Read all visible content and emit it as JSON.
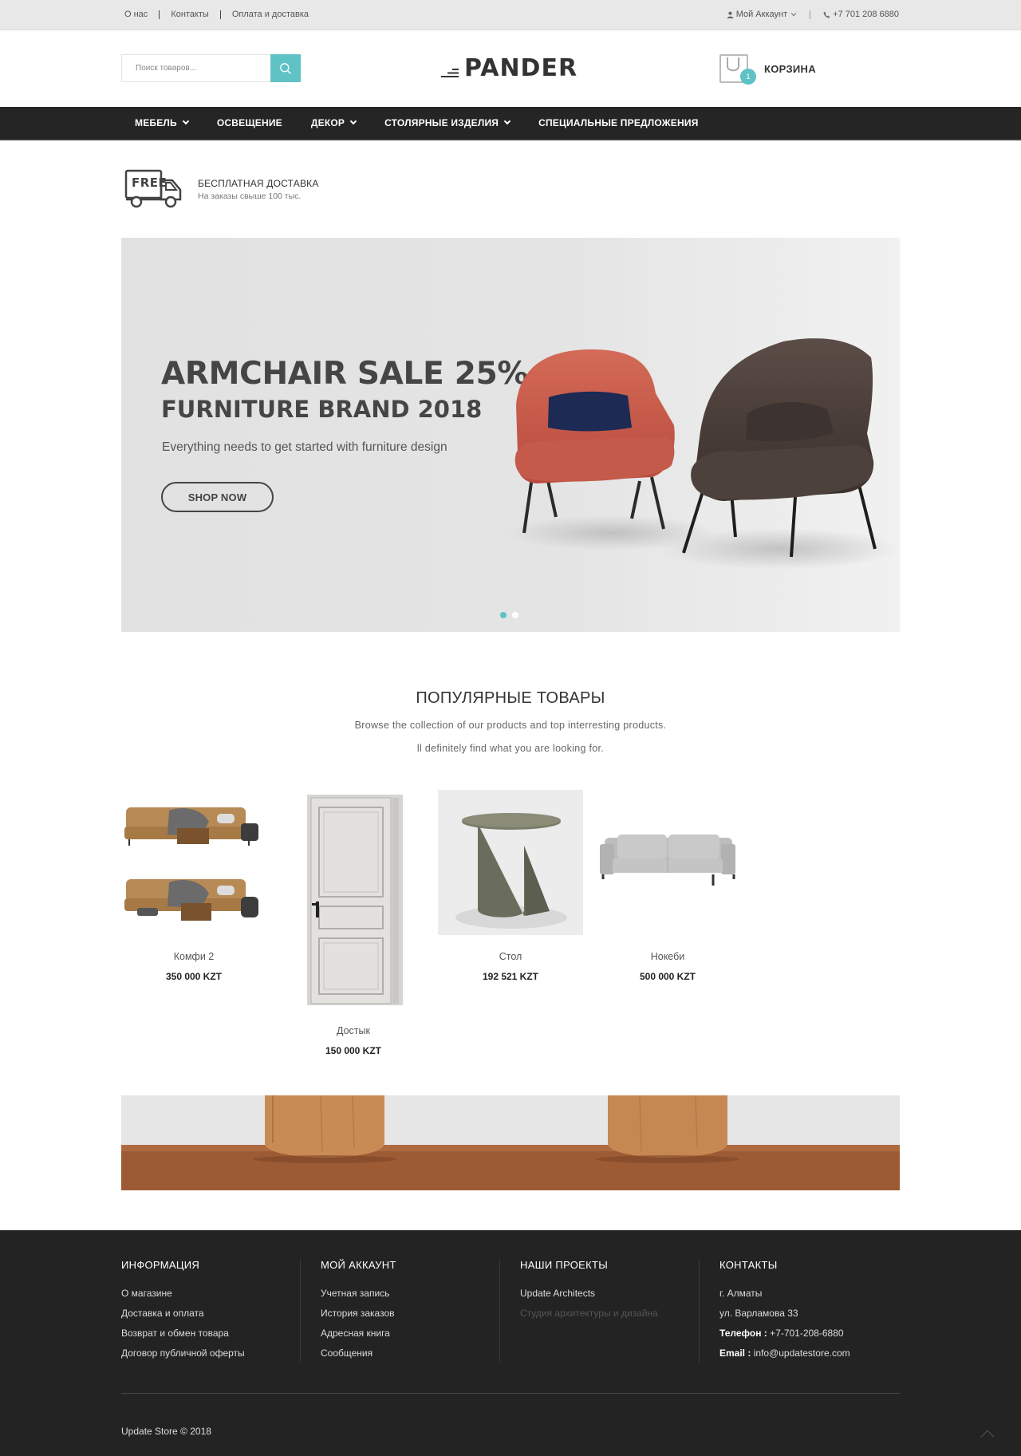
{
  "topbar": {
    "links": [
      "О нас",
      "Контакты",
      "Оплата и доставка"
    ],
    "account": "Мой Аккаунт",
    "phone": "+7 701 208 6880"
  },
  "header": {
    "search_placeholder": "Поиск товаров...",
    "logo": "PANDER",
    "cart_label": "КОРЗИНА",
    "cart_count": "1"
  },
  "nav": {
    "items": [
      {
        "label": "МЕБЕЛЬ",
        "has_dropdown": true
      },
      {
        "label": "ОСВЕЩЕНИЕ",
        "has_dropdown": false
      },
      {
        "label": "ДЕКОР",
        "has_dropdown": true
      },
      {
        "label": "СТОЛЯРНЫЕ ИЗДЕЛИЯ",
        "has_dropdown": true
      },
      {
        "label": "СПЕЦИАЛЬНЫЕ ПРЕДЛОЖЕНИЯ",
        "has_dropdown": false
      }
    ]
  },
  "shipping": {
    "badge": "FREE",
    "title": "БЕСПЛАТНАЯ ДОСТАВКА",
    "subtitle": "На заказы свыше 100 тыс."
  },
  "slider": {
    "heading": "ARMCHAIR SALE 25% OFF",
    "subheading": "FURNITURE BRAND 2018",
    "description": "Everything needs to get started with furniture design",
    "button": "SHOP NOW",
    "slides": 2,
    "active_slide": 1
  },
  "popular": {
    "title": "ПОПУЛЯРНЫЕ ТОВАРЫ",
    "subtitle_1": "Browse the collection of our products and top interresting products.",
    "subtitle_2": "ll definitely find what you are looking for.",
    "products": [
      {
        "name": "Комфи 2",
        "price": "350 000 KZT",
        "image": "sofa-set-image"
      },
      {
        "name": "Достык",
        "price": "150 000 KZT",
        "image": "door-image"
      },
      {
        "name": "Стол",
        "price": "192 521 KZT",
        "image": "side-table-image"
      },
      {
        "name": "Нокеби",
        "price": "500 000 KZT",
        "image": "grey-sofa-image"
      }
    ]
  },
  "footer": {
    "columns": [
      {
        "title": "ИНФОРМАЦИЯ",
        "items": [
          "О магазине",
          "Доставка и оплата",
          "Возврат и обмен товара",
          "Договор публичной оферты"
        ]
      },
      {
        "title": "МОЙ АККАУНТ",
        "items": [
          "Учетная запись",
          "История заказов",
          "Адресная книга",
          "Сообщения"
        ]
      },
      {
        "title": "НАШИ ПРОЕКТЫ",
        "items": [
          "Update Architects",
          "Студия архитектуры и дизайна"
        ]
      },
      {
        "title": "КОНТАКТЫ",
        "city": "г. Алматы",
        "address": "ул. Варламова 33",
        "phone_label": "Телефон :",
        "phone": "+7-701-208-6880",
        "email_label": "Email :",
        "email": "info@updatestore.com"
      }
    ],
    "copyright": "Update Store © 2018"
  },
  "colors": {
    "accent": "#5fc3c6",
    "nav_bg": "#252525",
    "footer_bg": "#232323",
    "topbar_bg": "#e8e8e8"
  }
}
